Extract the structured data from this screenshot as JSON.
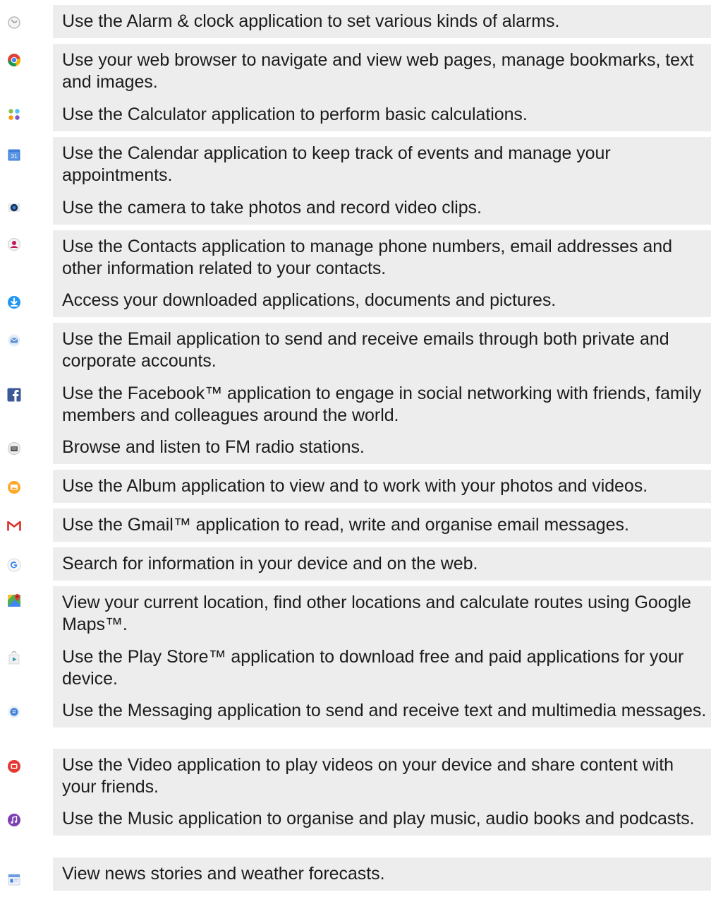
{
  "apps": [
    {
      "icon": "alarm-clock-icon",
      "text": "Use the Alarm & clock application to set various kinds of alarms."
    },
    {
      "icon": "chrome-browser-icon",
      "text": "Use your web browser to navigate and view web pages, manage bookmarks, text and images."
    },
    {
      "icon": "calculator-icon",
      "text": "Use the Calculator application to perform basic calculations."
    },
    {
      "icon": "calendar-icon",
      "text": "Use the Calendar application to keep track of events and manage your appointments."
    },
    {
      "icon": "camera-icon",
      "text": "Use the camera to take photos and record video clips."
    },
    {
      "icon": "contacts-icon",
      "text": "Use the Contacts application to manage phone numbers, email addresses and other information related to your contacts."
    },
    {
      "icon": "downloads-icon",
      "text": "Access your downloaded applications, documents and pictures."
    },
    {
      "icon": "email-icon",
      "text": "Use the Email application to send and receive emails through both private and corporate accounts."
    },
    {
      "icon": "facebook-icon",
      "text": "Use the Facebook™ application to engage in social networking with friends, family members and colleagues around the world."
    },
    {
      "icon": "fm-radio-icon",
      "text": "Browse and listen to FM radio stations."
    },
    {
      "icon": "album-icon",
      "text": "Use the Album application to view and to work with your photos and videos."
    },
    {
      "icon": "gmail-icon",
      "text": "Use the Gmail™ application to read, write and organise email messages."
    },
    {
      "icon": "google-search-icon",
      "text": "Search for information in your device and on the web."
    },
    {
      "icon": "google-maps-icon",
      "text": "View your current location, find other locations and calculate routes using Google Maps™."
    },
    {
      "icon": "play-store-icon",
      "text": "Use the Play Store™ application to download free and paid applications for your device."
    },
    {
      "icon": "messaging-icon",
      "text": "Use the Messaging application to send and receive text and multimedia messages."
    },
    {
      "icon": "video-icon",
      "text": "Use the Video application to play videos on your device and share content with your friends."
    },
    {
      "icon": "music-icon",
      "text": "Use the Music application to organise and play music, audio books and podcasts."
    },
    {
      "icon": "news-weather-icon",
      "text": "View news stories and weather forecasts."
    }
  ]
}
